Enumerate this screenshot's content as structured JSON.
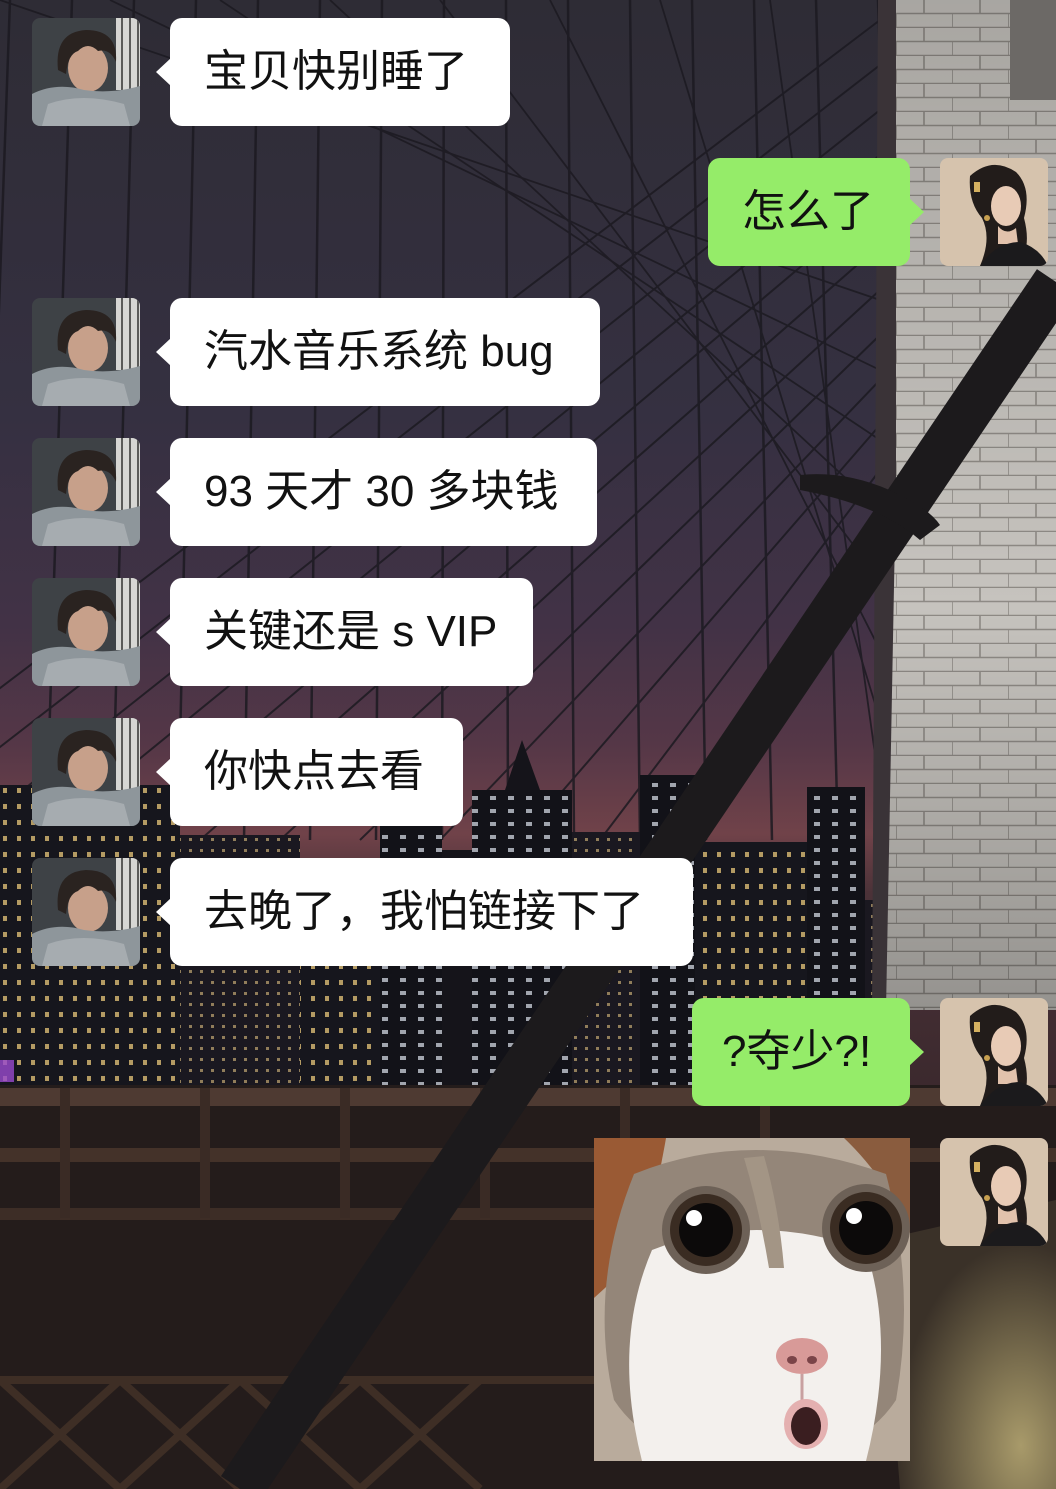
{
  "colors": {
    "incoming_bubble": "#ffffff",
    "outgoing_bubble": "#95ec69"
  },
  "contacts": {
    "other": {
      "avatar_icon": "young-man-avatar-icon"
    },
    "self": {
      "avatar_icon": "young-woman-avatar-icon"
    }
  },
  "background_icon": "night-bridge-city-photo",
  "messages": [
    {
      "outgoing": false,
      "text": "宝贝快别睡了"
    },
    {
      "outgoing": true,
      "text": "怎么了"
    },
    {
      "outgoing": false,
      "text": "汽水音乐系统 bug"
    },
    {
      "outgoing": false,
      "text": "93 天才 30 多块钱"
    },
    {
      "outgoing": false,
      "text": "关键还是 s VIP"
    },
    {
      "outgoing": false,
      "text": "你快点去看"
    },
    {
      "outgoing": false,
      "text": "去晚了，我怕链接下了"
    },
    {
      "outgoing": true,
      "text": "?夺少?!"
    },
    {
      "outgoing": true,
      "sticker_icon": "surprised-cat-sticker"
    }
  ]
}
